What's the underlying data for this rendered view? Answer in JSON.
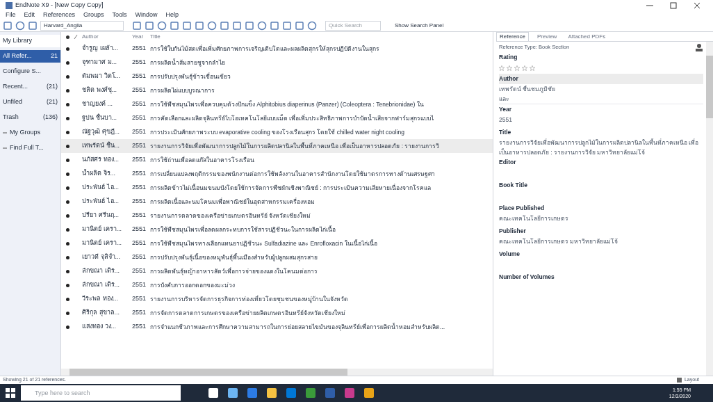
{
  "window": {
    "title": "EndNote X9 - [New Copy Copy]"
  },
  "menu": [
    "File",
    "Edit",
    "References",
    "Groups",
    "Tools",
    "Window",
    "Help"
  ],
  "toolbar": {
    "style": "Harvard_Anglia",
    "search_placeholder": "Quick Search",
    "search_panel": "Show Search Panel"
  },
  "sidebar": {
    "items": [
      {
        "label": "My Library",
        "kind": "header",
        "selected": false
      },
      {
        "label": "All Refer...",
        "count": "21",
        "kind": "item",
        "selected": true
      },
      {
        "label": "Configure S...",
        "kind": "item",
        "selected": false
      },
      {
        "label": "Recent...",
        "count": "(21)",
        "kind": "item",
        "selected": false
      },
      {
        "label": "Unfiled",
        "count": "(21)",
        "kind": "item",
        "selected": false
      },
      {
        "label": "Trash",
        "count": "(136)",
        "kind": "item",
        "selected": false
      },
      {
        "label": "My Groups",
        "kind": "group",
        "selected": false
      },
      {
        "label": "Find Full T...",
        "kind": "group",
        "selected": false
      }
    ]
  },
  "table": {
    "columns": [
      "Author",
      "Year",
      "Title"
    ],
    "rows": [
      {
        "author": "จำรูญ เผล้า...",
        "year": "2551",
        "title": "การใช้ใบกันไม้สดเพื่อเพิ่มศักยภาพการเจริญเติบโตและผลผลิตสุกรให้สุกรปฏิบัติงานในสุกร",
        "selected": false
      },
      {
        "author": "จุฑามาศ ม...",
        "year": "2551",
        "title": "การผลิตน้ำส้มสายชูจากลำไย",
        "selected": false
      },
      {
        "author": "ดัมพมา วิตโ...",
        "year": "2551",
        "title": "การปรับปรุงพันธุ์ข้าวเขื่อนเขียว",
        "selected": false
      },
      {
        "author": "ชลิต พงศ์ชุ...",
        "year": "2551",
        "title": "การผลิตไผ่แบบบูรณาการ",
        "selected": false
      },
      {
        "author": "ชาญยงค์ ...",
        "year": "2551",
        "title": "การใช้พืชสมุนไพรเพื่อควบคุมด้วงปีกแข็ง Alphitobius diaperinus (Panzer) (Coleoptera : Tenebrionidae) ใน",
        "selected": false
      },
      {
        "author": "ฐปน ชื่นบา...",
        "year": "2551",
        "title": "การคัดเลือกและผลิตจุลินทรีย์ไบโอเทคโนโลยีแบบเม็ด เพื่อเพิ่มประสิทธิภาพการบำบัดน้ำเสียจากฟาร์มสุกรแบบไ",
        "selected": false
      },
      {
        "author": "ณัฐวุฒิ ศุขฎี...",
        "year": "2551",
        "title": "การประเมินศักยภาพระบบ evaporative cooling ของโรงเรือนสุกร โดยใช้ chilled water night cooling",
        "selected": false
      },
      {
        "author": "เทพรัตน์ ชื่น...",
        "year": "2551",
        "title": "รายงานการวิจัยเพื่อพัฒนาการปลูกไม้ในการผลิตปลานิลในพื้นที่ภาคเหนือ เพื่อเป็นอาหารปลอดภัย : รายงานการวิ",
        "selected": true
      },
      {
        "author": "นภัสศร ทอง...",
        "year": "2551",
        "title": "การใช้ถ่านเพื่อลดแก๊สในอาคารโรงเรือน",
        "selected": false
      },
      {
        "author": "น้ำผลิต จิร...",
        "year": "2551",
        "title": "การเปลี่ยนแปลงพฤติกรรมของพนักงานต่อการใช้พลังงานในอาคารสำนักงานโดยใช้มาตรการทางด้านเศรษฐศา",
        "selected": false
      },
      {
        "author": "ประพันธ์ ไอ...",
        "year": "2551",
        "title": "การผลิตข้าวไม่เนื้อนมขนมปังโดยใช้การจัดการพืชผักเชิงพาณิชย์ : การประเมินความเสียหายเนื่องจากโรคแล",
        "selected": false
      },
      {
        "author": "ประพันธ์ ไอ...",
        "year": "2551",
        "title": "การผลิตเนื้อและนมโคนมเพื่อพาณิชย์ในอุตสาหกรรมเครื่องหอม",
        "selected": false
      },
      {
        "author": "ปรียา ศรีนฤ...",
        "year": "2551",
        "title": "รายงานการตลาดของเครือข่ายเกษตรอินทรีย์ จังหวัดเชียงใหม่",
        "selected": false
      },
      {
        "author": "มานิตย์ เครา...",
        "year": "2551",
        "title": "การใช้พืชสมุนไพรเพื่อลดผลกระทบการใช้สารปฏิชีวนะในการผลิตไก่เนื้อ",
        "selected": false
      },
      {
        "author": "มานิตย์ เครา...",
        "year": "2551",
        "title": "การใช้พืชสมุนไพรทางเลือกแทนยาปฏิชีวนะ Sulfadiazine และ Enrofloxacin ในเนื้อไก่เนื้อ",
        "selected": false
      },
      {
        "author": "เยาวดี จุลิจำ...",
        "year": "2551",
        "title": "การปรับปรุงพันธุ์เนื้อของหมูพันธุ์พื้นเมืองสำหรับผู้ปลูกผสมสุกรสาย",
        "selected": false
      },
      {
        "author": "ลักขณา เดิร...",
        "year": "2551",
        "title": "การผลิตพันธุ์หญ้าอาหารสัตว์เพื่อการจ่ายของแดงในโคนมต่อการ",
        "selected": false
      },
      {
        "author": "ลักขณา เดิร...",
        "year": "2551",
        "title": "การบังคับการออกดอกของมะม่วง",
        "selected": false
      },
      {
        "author": "วีระพล ทอง...",
        "year": "2551",
        "title": "รายงานการบริหารจัดการธุรกิจการท่องเที่ยวโดยชุมชนของหมู่บ้านในจังหวัด",
        "selected": false
      },
      {
        "author": "ศิริกุล สุขาล...",
        "year": "2551",
        "title": "การจัดการตลาดการเกษตรของเครือข่ายผลิตเกษตรอินทรีย์จังหวัดเชียงใหม่",
        "selected": false
      },
      {
        "author": "แสงทอง วง...",
        "year": "2551",
        "title": "การจำแนกชีวภาพและการศึกษาความสามารถในการย่อยสลายไขมันของจุลินทรีย์เพื่อการผลิตน้ำหอมสำหรับผลิต...",
        "selected": false
      }
    ]
  },
  "panel": {
    "tabs": [
      {
        "label": "Reference",
        "selected": true
      },
      {
        "label": "Preview",
        "selected": false
      },
      {
        "label": "Attached PDFs",
        "selected": false
      }
    ],
    "reference_type": "Reference Type: Book Section",
    "rating": {
      "label": "Rating",
      "stars": 0
    },
    "fields": [
      {
        "label": "Author",
        "lines": [
          "เทพรัตน์ ชื่นชมภูมิชัย",
          "และ"
        ],
        "selected": true
      },
      {
        "label": "Year",
        "lines": [
          "2551"
        ],
        "selected": false
      },
      {
        "label": "Title",
        "lines": [
          "รายงานการวิจัยเพื่อพัฒนาการปลูกไม้ในการผลิตปลานิลในพื้นที่ภาคเหนือ เพื่อเป็นอาหารปลอดภัย : รายงานการวิจัย มหาวิทยาลัยแม่โจ้"
        ],
        "selected": false
      },
      {
        "label": "Editor",
        "selected": false
      },
      {
        "label": "Book Title",
        "selected": false
      },
      {
        "label": "Place Published",
        "lines": [
          "คณะเทคโนโลยีการเกษตร"
        ],
        "selected": false
      },
      {
        "label": "Publisher",
        "lines": [
          "คณะเทคโนโลยีการเกษตร มหาวิทยาลัยแม่โจ้"
        ],
        "selected": false
      },
      {
        "label": "Volume",
        "selected": false
      },
      {
        "label": "Number of Volumes",
        "selected": false
      }
    ]
  },
  "status_bar": {
    "text": "Showing 21 of 21 references.",
    "layout": "Layout"
  },
  "taskbar": {
    "search_placeholder": "Type here to search",
    "time": "1:55 PM",
    "date": "12/3/2020"
  }
}
